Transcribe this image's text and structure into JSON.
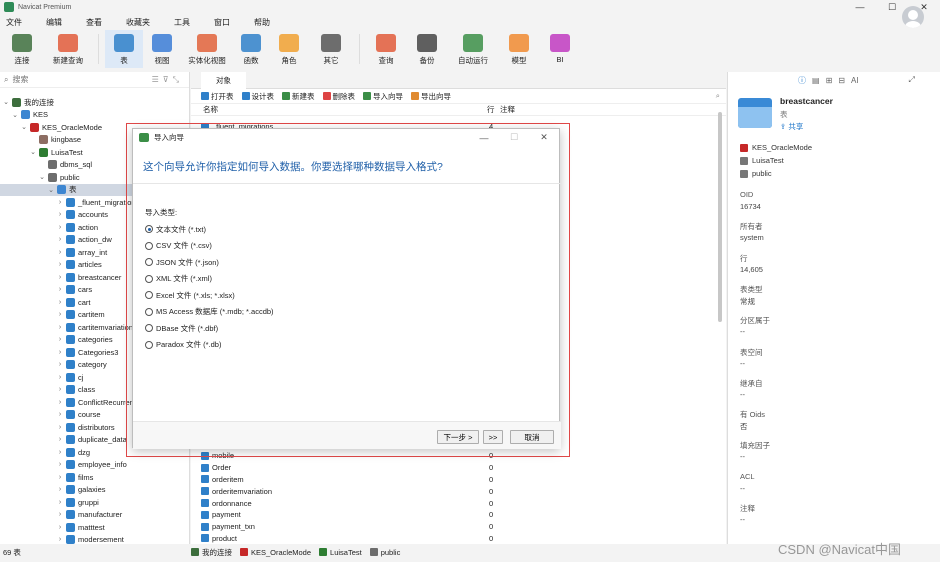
{
  "app_title": "Navicat Premium",
  "menu": [
    "文件",
    "编辑",
    "查看",
    "收藏夹",
    "工具",
    "窗口",
    "帮助"
  ],
  "toolbar": [
    {
      "label": "连接",
      "icon": "connection-icon"
    },
    {
      "label": "新建查询",
      "icon": "new-query-icon"
    },
    {
      "label": "表",
      "icon": "table-icon",
      "active": true
    },
    {
      "label": "视图",
      "icon": "view-icon"
    },
    {
      "label": "实体化视图",
      "icon": "materialized-view-icon"
    },
    {
      "label": "函数",
      "icon": "function-icon"
    },
    {
      "label": "角色",
      "icon": "role-icon"
    },
    {
      "label": "其它",
      "icon": "other-icon"
    },
    {
      "label": "查询",
      "icon": "query-icon"
    },
    {
      "label": "备份",
      "icon": "backup-icon"
    },
    {
      "label": "自动运行",
      "icon": "automation-icon"
    },
    {
      "label": "模型",
      "icon": "model-icon"
    },
    {
      "label": "BI",
      "icon": "bi-icon"
    }
  ],
  "left": {
    "search_placeholder": "搜索",
    "tree": [
      {
        "label": "我的连接",
        "level": 0,
        "icon": "ic-conn",
        "tw": "⌄"
      },
      {
        "label": "KES",
        "level": 1,
        "icon": "ic-folder",
        "tw": "⌄"
      },
      {
        "label": "KES_OracleMode",
        "level": 2,
        "icon": "ic-kes",
        "tw": "⌄"
      },
      {
        "label": "kingbase",
        "level": 3,
        "icon": "ic-db",
        "tw": ""
      },
      {
        "label": "LuisaTest",
        "level": 3,
        "icon": "ic-dbg",
        "tw": "⌄"
      },
      {
        "label": "dbms_sql",
        "level": 4,
        "icon": "ic-schema",
        "tw": ""
      },
      {
        "label": "public",
        "level": 4,
        "icon": "ic-schema",
        "tw": "⌄"
      },
      {
        "label": "表",
        "level": 5,
        "icon": "ic-folder",
        "tw": "⌄",
        "selected": true
      },
      {
        "label": "_fluent_migrations",
        "level": 6,
        "icon": "ic-table",
        "tw": "›"
      },
      {
        "label": "accounts",
        "level": 6,
        "icon": "ic-table",
        "tw": "›"
      },
      {
        "label": "action",
        "level": 6,
        "icon": "ic-table",
        "tw": "›"
      },
      {
        "label": "action_dw",
        "level": 6,
        "icon": "ic-table",
        "tw": "›"
      },
      {
        "label": "array_int",
        "level": 6,
        "icon": "ic-table",
        "tw": "›"
      },
      {
        "label": "articles",
        "level": 6,
        "icon": "ic-table",
        "tw": "›"
      },
      {
        "label": "breastcancer",
        "level": 6,
        "icon": "ic-table",
        "tw": "›"
      },
      {
        "label": "cars",
        "level": 6,
        "icon": "ic-table",
        "tw": "›"
      },
      {
        "label": "cart",
        "level": 6,
        "icon": "ic-table",
        "tw": "›"
      },
      {
        "label": "cartitem",
        "level": 6,
        "icon": "ic-table",
        "tw": "›"
      },
      {
        "label": "cartitemvariation",
        "level": 6,
        "icon": "ic-table",
        "tw": "›"
      },
      {
        "label": "categories",
        "level": 6,
        "icon": "ic-table",
        "tw": "›"
      },
      {
        "label": "Categories3",
        "level": 6,
        "icon": "ic-table",
        "tw": "›"
      },
      {
        "label": "category",
        "level": 6,
        "icon": "ic-table",
        "tw": "›"
      },
      {
        "label": "cj",
        "level": 6,
        "icon": "ic-table",
        "tw": "›"
      },
      {
        "label": "class",
        "level": 6,
        "icon": "ic-table",
        "tw": "›"
      },
      {
        "label": "ConflictRecurrence",
        "level": 6,
        "icon": "ic-table",
        "tw": "›"
      },
      {
        "label": "course",
        "level": 6,
        "icon": "ic-table",
        "tw": "›"
      },
      {
        "label": "distributors",
        "level": 6,
        "icon": "ic-table",
        "tw": "›"
      },
      {
        "label": "duplicate_data",
        "level": 6,
        "icon": "ic-table",
        "tw": "›"
      },
      {
        "label": "dzg",
        "level": 6,
        "icon": "ic-table",
        "tw": "›"
      },
      {
        "label": "employee_info",
        "level": 6,
        "icon": "ic-table",
        "tw": "›"
      },
      {
        "label": "films",
        "level": 6,
        "icon": "ic-table",
        "tw": "›"
      },
      {
        "label": "galaxies",
        "level": 6,
        "icon": "ic-table",
        "tw": "›"
      },
      {
        "label": "gruppi",
        "level": 6,
        "icon": "ic-table",
        "tw": "›"
      },
      {
        "label": "manufacturer",
        "level": 6,
        "icon": "ic-table",
        "tw": "›"
      },
      {
        "label": "matttest",
        "level": 6,
        "icon": "ic-table",
        "tw": "›"
      },
      {
        "label": "modersement",
        "level": 6,
        "icon": "ic-table",
        "tw": "›"
      }
    ],
    "status": "69 表"
  },
  "mid": {
    "tab": "对象",
    "tools": [
      "打开表",
      "设计表",
      "新建表",
      "删除表",
      "导入向导",
      "导出向导"
    ],
    "col_name": "名称",
    "col_rows": "行",
    "col_comment": "注释",
    "first_row": {
      "name": "_fluent_migrations",
      "rows": "4"
    },
    "rows": [
      {
        "name": "mobile",
        "rows": "0"
      },
      {
        "name": "Order",
        "rows": "0"
      },
      {
        "name": "orderitem",
        "rows": "0"
      },
      {
        "name": "orderitemvariation",
        "rows": "0"
      },
      {
        "name": "ordonnance",
        "rows": "0"
      },
      {
        "name": "payment",
        "rows": "0"
      },
      {
        "name": "payment_txn",
        "rows": "0"
      },
      {
        "name": "product",
        "rows": "0"
      }
    ]
  },
  "right": {
    "name": "breastcancer",
    "type": "表",
    "share": "共享",
    "conn": "KES_OracleMode",
    "db": "LuisaTest",
    "schema": "public",
    "props": [
      {
        "label": "OID",
        "value": "16734"
      },
      {
        "label": "所有者",
        "value": "system"
      },
      {
        "label": "行",
        "value": "14,605"
      },
      {
        "label": "表类型",
        "value": "常规"
      },
      {
        "label": "分区属于",
        "value": "--"
      },
      {
        "label": "表空间",
        "value": "--"
      },
      {
        "label": "继承自",
        "value": "--"
      },
      {
        "label": "有 Oids",
        "value": "否"
      },
      {
        "label": "填充因子",
        "value": "--"
      },
      {
        "label": "ACL",
        "value": "--"
      },
      {
        "label": "注释",
        "value": "--"
      }
    ]
  },
  "status_bar": {
    "conn_group": "我的连接",
    "conn": "KES_OracleMode",
    "db": "LuisaTest",
    "schema": "public"
  },
  "watermark": "CSDN @Navicat中国",
  "dialog": {
    "title": "导入向导",
    "heading": "这个向导允许你指定如何导入数据。你要选择哪种数据导入格式?",
    "import_type_label": "导入类型:",
    "options": [
      {
        "label": "文本文件 (*.txt)",
        "selected": true
      },
      {
        "label": "CSV 文件 (*.csv)",
        "selected": false
      },
      {
        "label": "JSON 文件 (*.json)",
        "selected": false
      },
      {
        "label": "XML 文件 (*.xml)",
        "selected": false
      },
      {
        "label": "Excel 文件 (*.xls; *.xlsx)",
        "selected": false
      },
      {
        "label": "MS Access 数据库 (*.mdb; *.accdb)",
        "selected": false
      },
      {
        "label": "DBase 文件 (*.dbf)",
        "selected": false
      },
      {
        "label": "Paradox 文件 (*.db)",
        "selected": false
      }
    ],
    "next": "下一步 >",
    "last": ">>",
    "cancel": "取消"
  }
}
